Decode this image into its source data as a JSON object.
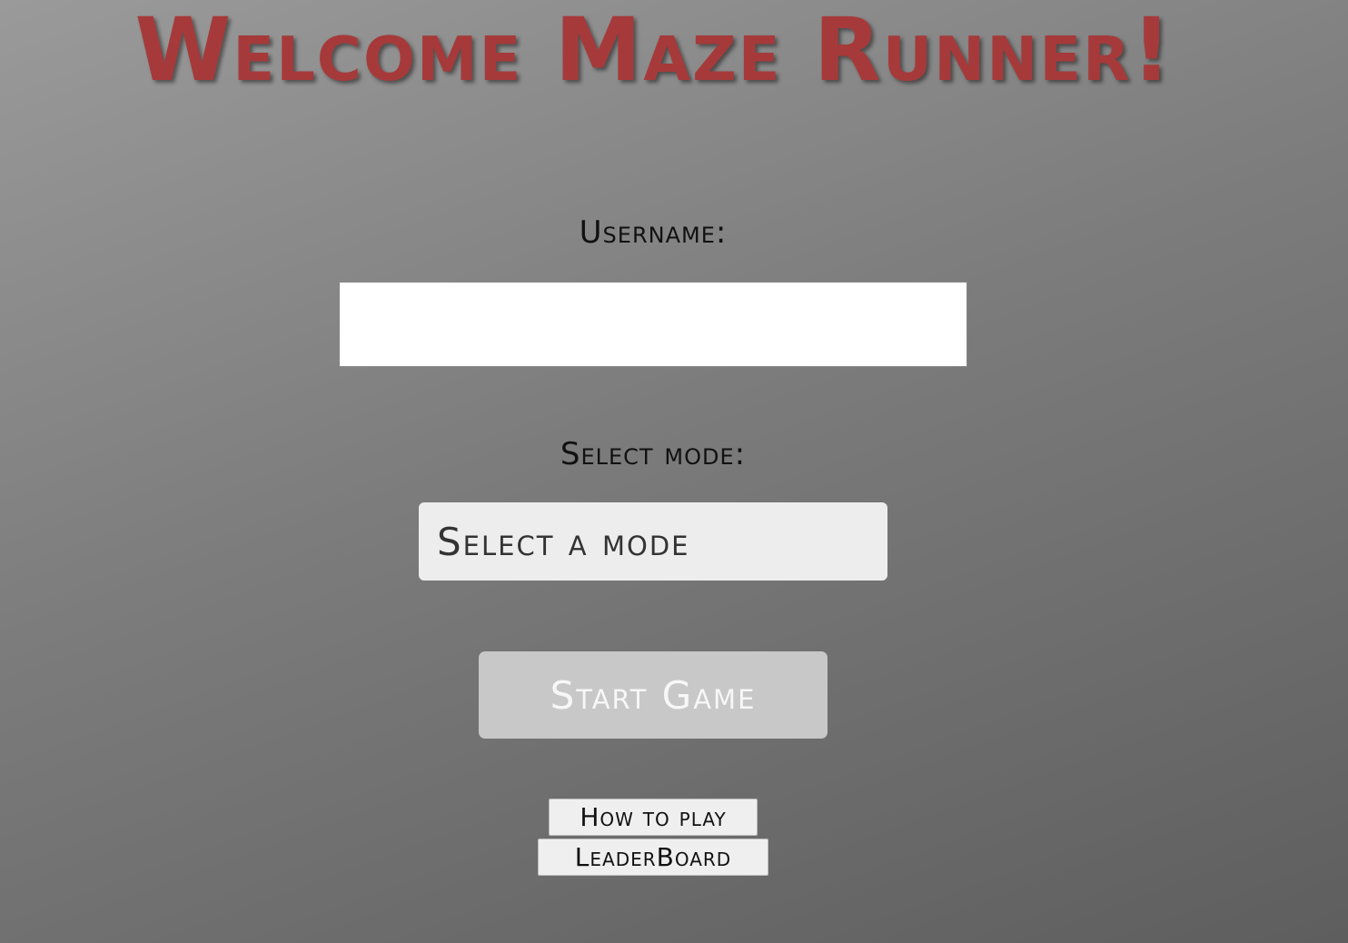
{
  "page": {
    "title": "Welcome Maze Runner!"
  },
  "form": {
    "username_label": "Username:",
    "username_value": "",
    "mode_label": "Select mode:",
    "mode_selected": "Select a mode",
    "start_label": "Start Game"
  },
  "links": {
    "how_to_play": "How to play",
    "leaderboard": "LeaderBoard"
  },
  "colors": {
    "title": "#a63a3a",
    "start_button_bg": "#c8c8c8",
    "select_bg": "#ededed"
  }
}
